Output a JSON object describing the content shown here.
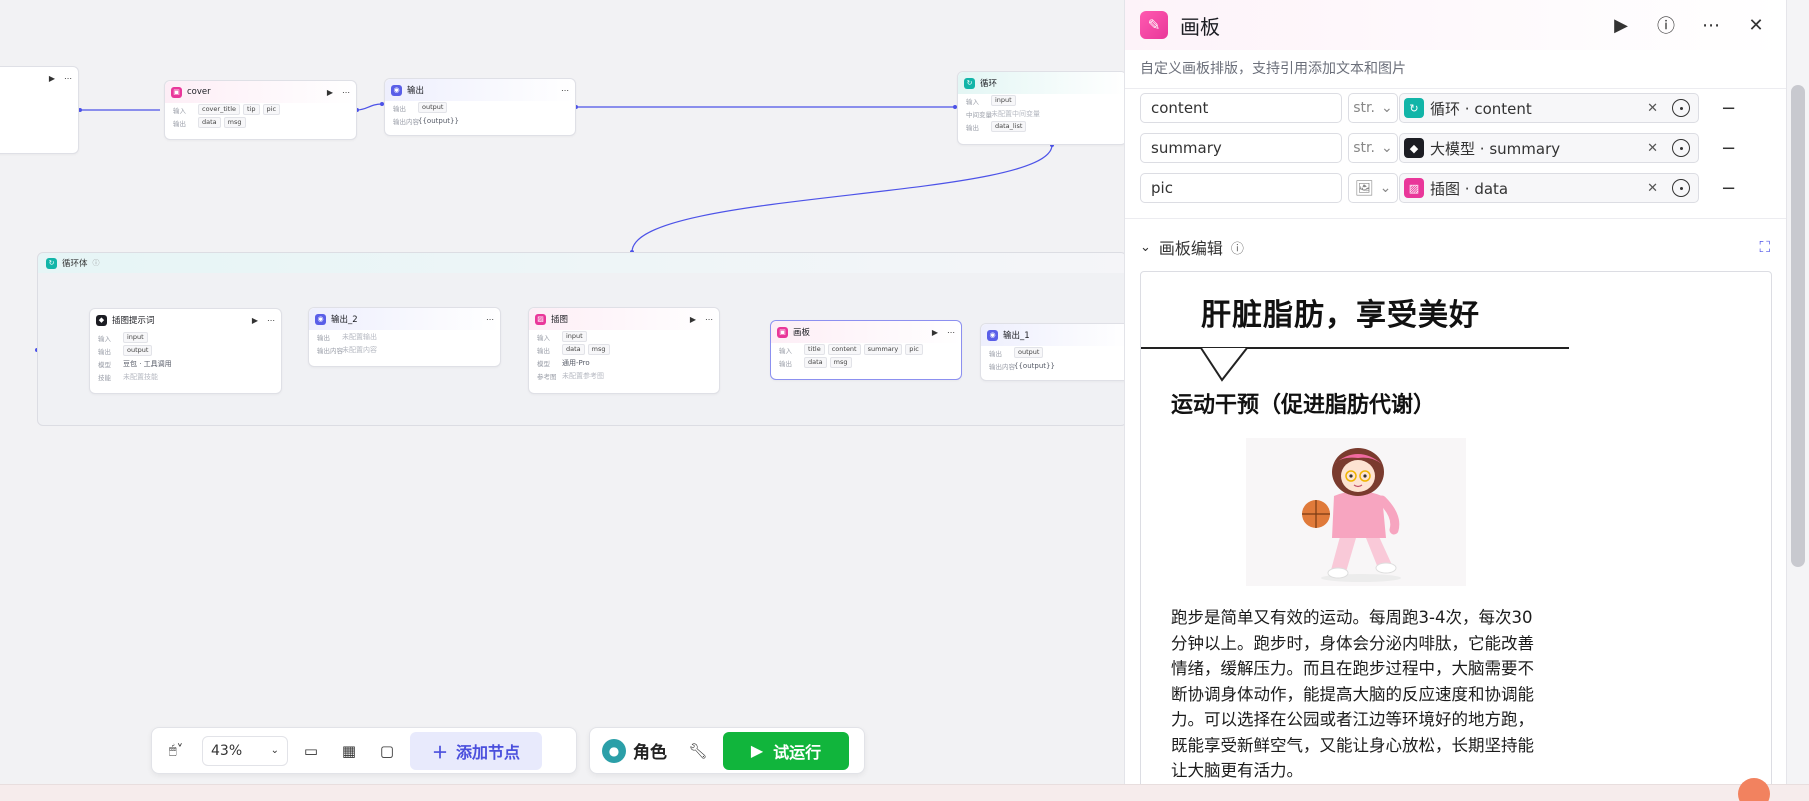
{
  "canvas": {
    "nodes": {
      "cover": {
        "title": "cover",
        "in_label": "输入",
        "in_tags": [
          "cover_title",
          "tip",
          "pic"
        ],
        "out_label": "输出",
        "out_tags": [
          "data",
          "msg"
        ]
      },
      "output": {
        "title": "输出",
        "out_label": "输出",
        "out_tag": "output",
        "content_label": "输出内容",
        "content": "{{output}}"
      },
      "loop": {
        "title": "循环",
        "in_label": "输入",
        "in_tag": "input",
        "mid_label": "中间变量",
        "mid": "未配置中间变量",
        "out_label": "输出",
        "out_tag": "data_list"
      },
      "loop_body": {
        "title": "循环体"
      },
      "illus_prompt": {
        "title": "插图提示词",
        "in_label": "输入",
        "in_tag": "input",
        "out_label": "输出",
        "out_tag": "output",
        "model_label": "模型",
        "model": "豆包 · 工具调用",
        "skill_label": "技能",
        "skill": "未配置技能"
      },
      "output2": {
        "title": "输出_2",
        "out_label": "输出",
        "out_val": "未配置输出",
        "content_label": "输出内容",
        "content": "未配置内容"
      },
      "illus": {
        "title": "插图",
        "in_label": "输入",
        "in_tag": "input",
        "out_label": "输出",
        "out_tags": [
          "data",
          "msg"
        ],
        "model_label": "模型",
        "model": "通用-Pro",
        "ref_label": "参考图",
        "ref": "未配置参考图"
      },
      "board": {
        "title": "画板",
        "in_label": "输入",
        "in_tags": [
          "title",
          "content",
          "summary",
          "pic"
        ],
        "out_label": "输出",
        "out_tags": [
          "data",
          "msg"
        ]
      },
      "output1": {
        "title": "输出_1",
        "out_label": "输出",
        "out_tag": "output",
        "content_label": "输出内容",
        "content": "{{output}}"
      }
    }
  },
  "toolbar": {
    "zoom": "43%",
    "add_node": "添加节点",
    "role": "角色",
    "run": "试运行"
  },
  "panel": {
    "title": "画板",
    "description": "自定义画板排版，支持引用添加文本和图片",
    "vars": [
      {
        "name": "content",
        "type": "str.",
        "ref_node": "循环",
        "ref_sep": " · ",
        "ref_field": "content",
        "color": "#12b5a8"
      },
      {
        "name": "summary",
        "type": "str.",
        "ref_node": "大模型",
        "ref_sep": " · ",
        "ref_field": "summary",
        "color": "#1c1d23"
      },
      {
        "name": "pic",
        "type": "image-icon",
        "ref_node": "插图",
        "ref_sep": " · ",
        "ref_field": "data",
        "color": "#e9379a"
      }
    ],
    "section_title": "画板编辑",
    "board": {
      "title": "肝脏脂肪，享受美好",
      "subtitle": "运动干预（促进脂肪代谢）",
      "body": "跑步是简单又有效的运动。每周跑3-4次，每次30分钟以上。跑步时，身体会分泌内啡肽，它能改善情绪，缓解压力。而且在跑步过程中，大脑需要不断协调身体动作，能提高大脑的反应速度和协调能力。可以选择在公园或者江边等环境好的地方跑，既能享受新鲜空气，又能让身心放松，长期坚持能让大脑更有活力。"
    }
  }
}
